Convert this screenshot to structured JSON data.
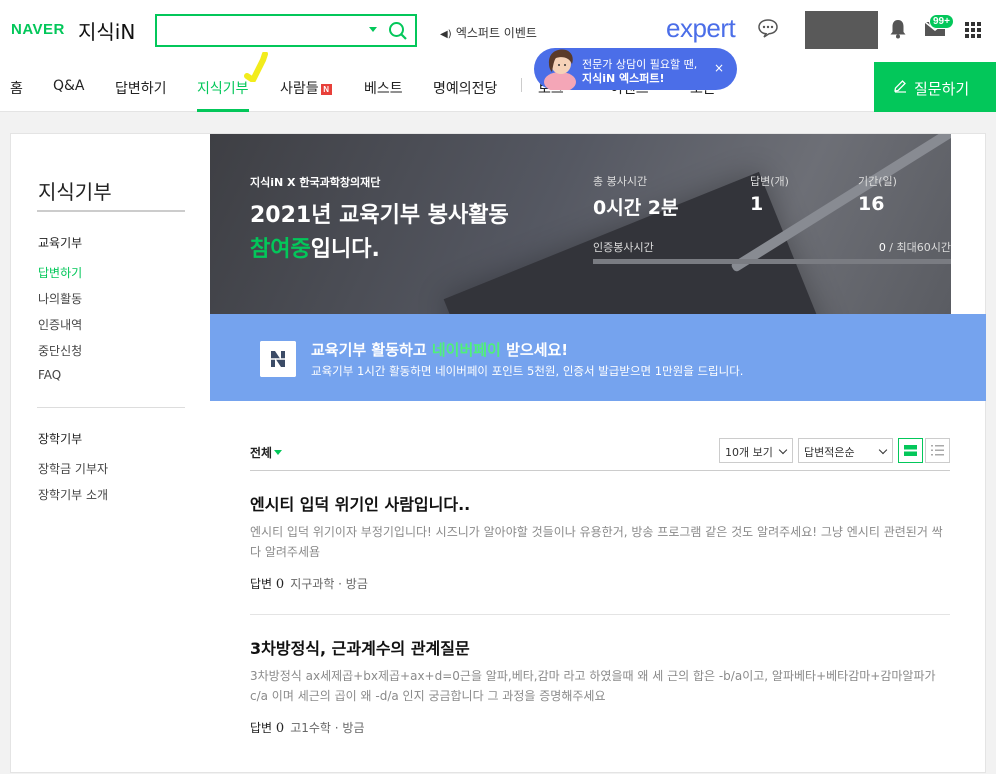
{
  "header": {
    "logo_naver": "NAVER",
    "logo_kin": "지식iN",
    "search_value": "",
    "expert_event": "엑스퍼트 이벤트",
    "expert_logo": "expert",
    "mail_badge": "99+",
    "ask_button": "질문하기"
  },
  "nav": {
    "items": [
      "홈",
      "Q&A",
      "답변하기",
      "지식기부",
      "사람들",
      "베스트",
      "명예의전당",
      "토크",
      "이벤트",
      "오픈"
    ],
    "new_badge": "N",
    "active": "지식기부"
  },
  "tooltip": {
    "line1": "전문가 상담이 필요할 땐,",
    "line2": "지식iN 엑스퍼트!",
    "close": "×"
  },
  "sidebar": {
    "title": "지식기부",
    "section1": "교육기부",
    "section1_links": [
      "답변하기",
      "나의활동",
      "인증내역",
      "중단신청",
      "FAQ"
    ],
    "section2": "장학기부",
    "section2_links": [
      "장학금 기부자",
      "장학기부 소개"
    ]
  },
  "hero": {
    "subtitle": "지식iN X 한국과학창의재단",
    "title_line1": "2021년 교육기부 봉사활동",
    "title_highlight": "참여중",
    "title_suffix": "입니다.",
    "stats": [
      {
        "label": "총 봉사시간",
        "value": "0시간 2분"
      },
      {
        "label": "답변(개)",
        "value": "1"
      },
      {
        "label": "기간(일)",
        "value": "16"
      }
    ],
    "cert_label": "인증봉사시간",
    "cert_value": "0",
    "cert_max": " / 최대60시간",
    "cert_progress": 0
  },
  "promo": {
    "title_prefix": "교육기부 활동하고 ",
    "title_highlight": "네이버페이",
    "title_suffix": " 받으세요!",
    "subtitle": "교육기부 1시간 활동하면 네이버페이 포인트 5천원, 인증서 발급받으면 1만원을 드립니다."
  },
  "toolbar": {
    "filter": "전체",
    "count_select": "10개 보기",
    "sort_select": "답변적은순"
  },
  "posts": [
    {
      "title": "엔시티 입덕 위기인 사람입니다..",
      "body": "엔시티 입덕 위기이자 부정기입니다! 시즈니가 알아야할 것들이나 유용한거, 방송 프로그램 같은 것도 알려주세요! 그냥 엔시티 관련된거 싹다 알려주세욤",
      "answer_label": "답변",
      "answer_count": "0",
      "category": "지구과학 · 방금"
    },
    {
      "title": "3차방정식, 근과계수의 관계질문",
      "body": "3차방정식 ax세제곱+bx제곱+ax+d=0근을 알파,베타,감마 라고 하였을때 왜 세 근의 합은 -b/a이고, 알파베타+베타감마+감마알파가 c/a 이며 세근의 곱이 왜 -d/a 인지 궁금합니다 그 과정을 증명해주세요",
      "answer_label": "답변",
      "answer_count": "0",
      "category": "고1수학 · 방금"
    }
  ],
  "colors": {
    "brand_green": "#03c75a",
    "expert_blue": "#4b6ee8",
    "promo_blue": "#75a3ee"
  }
}
